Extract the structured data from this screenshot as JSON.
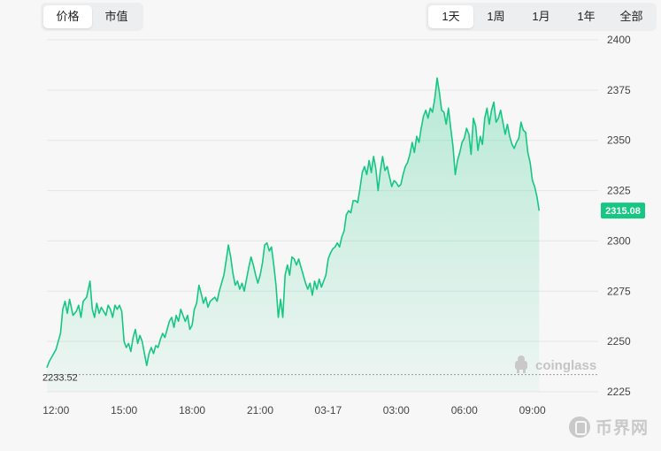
{
  "controls": {
    "metric_tabs": [
      {
        "label": "价格",
        "active": true
      },
      {
        "label": "市值",
        "active": false
      }
    ],
    "range_tabs": [
      {
        "label": "1天",
        "active": true
      },
      {
        "label": "1周",
        "active": false
      },
      {
        "label": "1月",
        "active": false
      },
      {
        "label": "1年",
        "active": false
      },
      {
        "label": "全部",
        "active": false
      }
    ]
  },
  "watermarks": {
    "chart": "coinglass",
    "site": "币界网"
  },
  "colors": {
    "line": "#16c784",
    "fill_top": "#16c784",
    "grid": "#e6e6e6",
    "axis_text": "#444444",
    "current_label_bg": "#16c784"
  },
  "chart_data": {
    "type": "area",
    "title": "",
    "xlabel": "",
    "ylabel": "",
    "ylim": [
      2225,
      2400
    ],
    "y_ticks": [
      2225,
      2250,
      2275,
      2300,
      2325,
      2350,
      2375,
      2400
    ],
    "x_ticks": [
      "12:00",
      "15:00",
      "18:00",
      "21:00",
      "03-17",
      "03:00",
      "06:00",
      "09:00"
    ],
    "x_tick_hours": [
      0,
      3,
      6,
      9,
      12,
      15,
      18,
      21
    ],
    "x_range_hours": [
      -0.4,
      23.9
    ],
    "baseline_label": "2233.52",
    "current_price_label": "2315.08",
    "grid": true,
    "series": [
      {
        "points": [
          [
            -0.4,
            2237
          ],
          [
            -0.3,
            2240
          ],
          [
            -0.15,
            2243
          ],
          [
            0.0,
            2246
          ],
          [
            0.1,
            2250
          ],
          [
            0.2,
            2254
          ],
          [
            0.3,
            2266
          ],
          [
            0.4,
            2270
          ],
          [
            0.5,
            2264
          ],
          [
            0.6,
            2271
          ],
          [
            0.75,
            2263
          ],
          [
            0.9,
            2265
          ],
          [
            1.0,
            2268
          ],
          [
            1.1,
            2262
          ],
          [
            1.2,
            2270
          ],
          [
            1.35,
            2272
          ],
          [
            1.5,
            2280
          ],
          [
            1.6,
            2266
          ],
          [
            1.7,
            2262
          ],
          [
            1.8,
            2269
          ],
          [
            1.9,
            2264
          ],
          [
            2.0,
            2267
          ],
          [
            2.1,
            2265
          ],
          [
            2.2,
            2263
          ],
          [
            2.3,
            2268
          ],
          [
            2.4,
            2266
          ],
          [
            2.5,
            2262
          ],
          [
            2.6,
            2268
          ],
          [
            2.7,
            2266
          ],
          [
            2.8,
            2268
          ],
          [
            2.9,
            2265
          ],
          [
            3.0,
            2250
          ],
          [
            3.1,
            2247
          ],
          [
            3.2,
            2249
          ],
          [
            3.3,
            2245
          ],
          [
            3.4,
            2252
          ],
          [
            3.5,
            2256
          ],
          [
            3.6,
            2249
          ],
          [
            3.7,
            2253
          ],
          [
            3.8,
            2250
          ],
          [
            3.9,
            2244
          ],
          [
            4.0,
            2238
          ],
          [
            4.1,
            2244
          ],
          [
            4.2,
            2247
          ],
          [
            4.3,
            2244
          ],
          [
            4.4,
            2248
          ],
          [
            4.5,
            2247
          ],
          [
            4.6,
            2251
          ],
          [
            4.7,
            2254
          ],
          [
            4.8,
            2252
          ],
          [
            4.9,
            2256
          ],
          [
            5.0,
            2260
          ],
          [
            5.1,
            2262
          ],
          [
            5.2,
            2257
          ],
          [
            5.3,
            2263
          ],
          [
            5.4,
            2260
          ],
          [
            5.5,
            2266
          ],
          [
            5.6,
            2263
          ],
          [
            5.7,
            2260
          ],
          [
            5.8,
            2263
          ],
          [
            5.9,
            2256
          ],
          [
            6.0,
            2258
          ],
          [
            6.1,
            2266
          ],
          [
            6.2,
            2269
          ],
          [
            6.3,
            2278
          ],
          [
            6.4,
            2274
          ],
          [
            6.5,
            2269
          ],
          [
            6.6,
            2272
          ],
          [
            6.7,
            2267
          ],
          [
            6.8,
            2270
          ],
          [
            6.9,
            2271
          ],
          [
            7.0,
            2272
          ],
          [
            7.1,
            2270
          ],
          [
            7.2,
            2275
          ],
          [
            7.3,
            2279
          ],
          [
            7.4,
            2283
          ],
          [
            7.5,
            2290
          ],
          [
            7.6,
            2298
          ],
          [
            7.7,
            2292
          ],
          [
            7.8,
            2284
          ],
          [
            7.9,
            2278
          ],
          [
            8.0,
            2280
          ],
          [
            8.1,
            2276
          ],
          [
            8.2,
            2279
          ],
          [
            8.3,
            2275
          ],
          [
            8.4,
            2281
          ],
          [
            8.5,
            2287
          ],
          [
            8.6,
            2292
          ],
          [
            8.7,
            2288
          ],
          [
            8.8,
            2283
          ],
          [
            8.9,
            2279
          ],
          [
            9.0,
            2283
          ],
          [
            9.1,
            2289
          ],
          [
            9.2,
            2298
          ],
          [
            9.3,
            2299
          ],
          [
            9.4,
            2295
          ],
          [
            9.5,
            2297
          ],
          [
            9.6,
            2288
          ],
          [
            9.7,
            2278
          ],
          [
            9.8,
            2262
          ],
          [
            9.9,
            2271
          ],
          [
            10.0,
            2262
          ],
          [
            10.1,
            2283
          ],
          [
            10.2,
            2288
          ],
          [
            10.3,
            2283
          ],
          [
            10.4,
            2292
          ],
          [
            10.5,
            2291
          ],
          [
            10.6,
            2288
          ],
          [
            10.7,
            2291
          ],
          [
            10.8,
            2287
          ],
          [
            10.9,
            2283
          ],
          [
            11.0,
            2279
          ],
          [
            11.1,
            2276
          ],
          [
            11.2,
            2279
          ],
          [
            11.3,
            2273
          ],
          [
            11.4,
            2280
          ],
          [
            11.5,
            2276
          ],
          [
            11.6,
            2281
          ],
          [
            11.7,
            2277
          ],
          [
            11.8,
            2280
          ],
          [
            11.9,
            2283
          ],
          [
            12.0,
            2291
          ],
          [
            12.1,
            2294
          ],
          [
            12.2,
            2296
          ],
          [
            12.3,
            2297
          ],
          [
            12.4,
            2299
          ],
          [
            12.5,
            2297
          ],
          [
            12.6,
            2302
          ],
          [
            12.7,
            2305
          ],
          [
            12.8,
            2313
          ],
          [
            12.9,
            2315
          ],
          [
            13.0,
            2314
          ],
          [
            13.1,
            2320
          ],
          [
            13.2,
            2320
          ],
          [
            13.3,
            2319
          ],
          [
            13.4,
            2326
          ],
          [
            13.5,
            2334
          ],
          [
            13.6,
            2337
          ],
          [
            13.7,
            2333
          ],
          [
            13.8,
            2340
          ],
          [
            13.9,
            2334
          ],
          [
            14.0,
            2342
          ],
          [
            14.1,
            2336
          ],
          [
            14.2,
            2325
          ],
          [
            14.3,
            2335
          ],
          [
            14.4,
            2342
          ],
          [
            14.5,
            2335
          ],
          [
            14.6,
            2337
          ],
          [
            14.7,
            2332
          ],
          [
            14.8,
            2327
          ],
          [
            14.9,
            2330
          ],
          [
            15.0,
            2329
          ],
          [
            15.1,
            2327
          ],
          [
            15.2,
            2328
          ],
          [
            15.3,
            2333
          ],
          [
            15.4,
            2337
          ],
          [
            15.5,
            2339
          ],
          [
            15.6,
            2343
          ],
          [
            15.7,
            2349
          ],
          [
            15.8,
            2344
          ],
          [
            15.9,
            2352
          ],
          [
            16.0,
            2349
          ],
          [
            16.1,
            2356
          ],
          [
            16.2,
            2362
          ],
          [
            16.3,
            2365
          ],
          [
            16.4,
            2361
          ],
          [
            16.5,
            2366
          ],
          [
            16.6,
            2364
          ],
          [
            16.7,
            2371
          ],
          [
            16.8,
            2381
          ],
          [
            16.9,
            2374
          ],
          [
            17.0,
            2365
          ],
          [
            17.1,
            2364
          ],
          [
            17.2,
            2358
          ],
          [
            17.3,
            2366
          ],
          [
            17.4,
            2356
          ],
          [
            17.5,
            2347
          ],
          [
            17.6,
            2333
          ],
          [
            17.7,
            2340
          ],
          [
            17.8,
            2344
          ],
          [
            17.9,
            2349
          ],
          [
            18.0,
            2351
          ],
          [
            18.1,
            2356
          ],
          [
            18.2,
            2353
          ],
          [
            18.3,
            2343
          ],
          [
            18.4,
            2361
          ],
          [
            18.5,
            2357
          ],
          [
            18.6,
            2345
          ],
          [
            18.7,
            2352
          ],
          [
            18.8,
            2348
          ],
          [
            18.9,
            2361
          ],
          [
            19.0,
            2366
          ],
          [
            19.1,
            2358
          ],
          [
            19.2,
            2365
          ],
          [
            19.3,
            2369
          ],
          [
            19.4,
            2359
          ],
          [
            19.5,
            2361
          ],
          [
            19.6,
            2365
          ],
          [
            19.7,
            2359
          ],
          [
            19.8,
            2353
          ],
          [
            19.9,
            2358
          ],
          [
            20.0,
            2352
          ],
          [
            20.1,
            2348
          ],
          [
            20.2,
            2346
          ],
          [
            20.3,
            2349
          ],
          [
            20.4,
            2351
          ],
          [
            20.5,
            2359
          ],
          [
            20.6,
            2355
          ],
          [
            20.7,
            2354
          ],
          [
            20.8,
            2344
          ],
          [
            20.9,
            2339
          ],
          [
            21.0,
            2330
          ],
          [
            21.1,
            2327
          ],
          [
            21.2,
            2322
          ],
          [
            21.3,
            2315
          ]
        ]
      }
    ]
  }
}
